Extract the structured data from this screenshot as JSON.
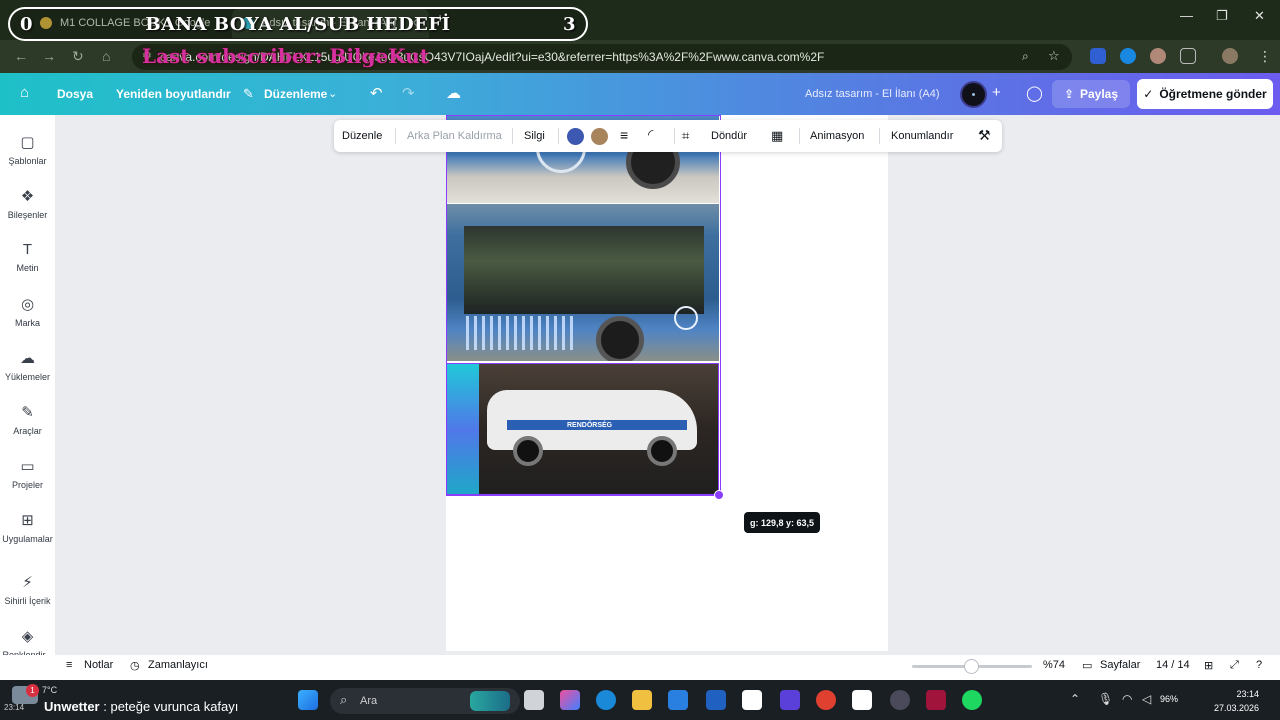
{
  "browser": {
    "tabs": [
      {
        "title": "M1 COLLAGE BOOK - Google"
      },
      {
        "title": "Adsız tasarım - El İlanı (A4)"
      }
    ],
    "new_tab": "+",
    "url": "canva.com/design/DAHFLXL15ug/UOkeJuO3uCsO43V7IOajA/edit?ui=e30&referrer=https%3A%2F%2Fwww.canva.com%2F"
  },
  "overlay": {
    "left_num": "0",
    "goal": "BANA BOYA AL/SUB HEDEFİ",
    "right_num": "3",
    "last_subscriber": "Last subscriber: BilgeKut"
  },
  "canva_bar": {
    "file": "Dosya",
    "resize": "Yeniden boyutlandır",
    "edit": "Düzenleme",
    "design_title": "Adsız tasarım - El İlanı (A4)",
    "share": "Paylaş",
    "send_teacher": "Öğretmene gönder"
  },
  "sidebar": {
    "items": [
      {
        "label": "Şablonlar",
        "icon": "templates-icon"
      },
      {
        "label": "Bileşenler",
        "icon": "elements-icon"
      },
      {
        "label": "Metin",
        "icon": "text-icon"
      },
      {
        "label": "Marka",
        "icon": "brand-icon"
      },
      {
        "label": "Yüklemeler",
        "icon": "uploads-icon"
      },
      {
        "label": "Araçlar",
        "icon": "tools-icon"
      },
      {
        "label": "Projeler",
        "icon": "projects-icon"
      },
      {
        "label": "Uygulamalar",
        "icon": "apps-icon"
      },
      {
        "label": "Sihirli İçerik",
        "icon": "magic-media-icon"
      },
      {
        "label": "Renklendir...",
        "icon": "colorize-icon"
      }
    ]
  },
  "context_toolbar": {
    "edit": "Düzenle",
    "bg_remove": "Arka Plan Kaldırma",
    "eraser": "Silgi",
    "colors": [
      "#3d58b0",
      "#a8845c"
    ],
    "rotate": "Döndür",
    "animate": "Animasyon",
    "position": "Konumlandır"
  },
  "canvas": {
    "car_text": "RENDŐRSÉG",
    "coord_tooltip": "g: 129,8 y: 63,5"
  },
  "bottom_bar": {
    "notes": "Notlar",
    "timer": "Zamanlayıcı",
    "zoom": "%74",
    "pages": "Sayfalar",
    "page_count": "14 / 14"
  },
  "taskbar": {
    "temp": "7°C",
    "notif_count": "1",
    "news_bold": "Unwetter",
    "news_rest": " : peteğe vurunca kafayı",
    "left_clock": "23:14",
    "search": "Ara",
    "battery": "96%",
    "time": "23:14",
    "date": "27.03.2026"
  }
}
